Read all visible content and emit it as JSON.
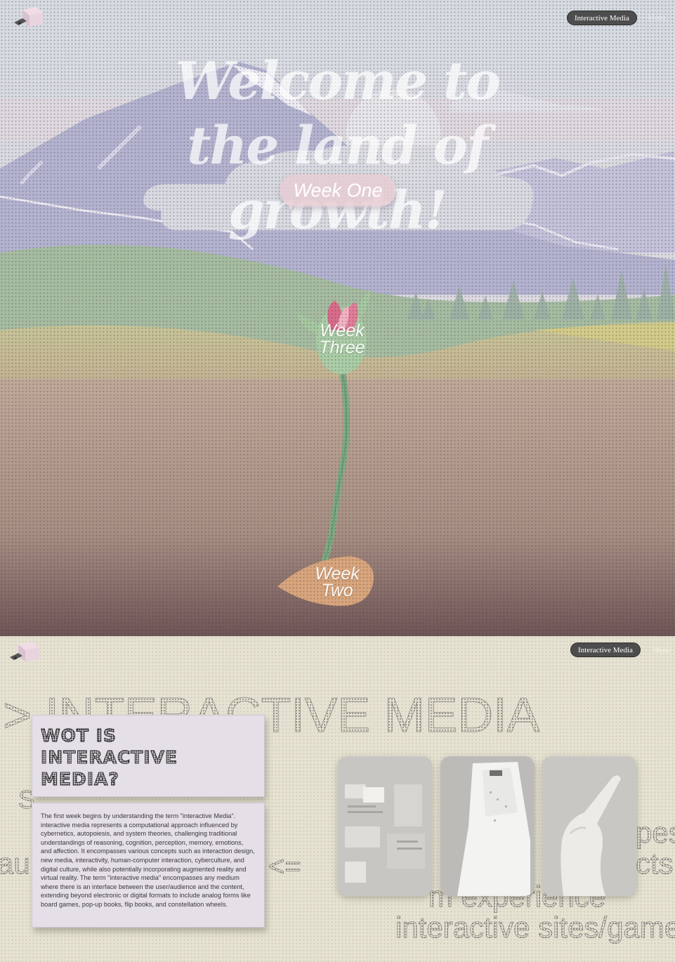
{
  "hero": {
    "nav": {
      "pill_label": "Interactive Media",
      "menu_label": "Menu"
    },
    "title": "Welcome to the land of growth!",
    "week_one": "Week One",
    "week_three": "Week Three",
    "week_two": "Week Two"
  },
  "im": {
    "nav": {
      "pill_label": "Interactive Media",
      "menu_label": "Menu"
    },
    "background_words": {
      "heading": "> INTERACTIVE MEDIA",
      "left_top": "S",
      "left_mid": "au",
      "arrow": "<=",
      "right_1": "pes",
      "right_2": "cts",
      "right_3": "m      experience",
      "right_4": "interactive sites/game"
    },
    "card": {
      "title": "WOT IS\nINTERACTIVE\nMEDIA?",
      "body": "The first week begins by understanding the term \"interactive Media\". interactive media represents a computational approach influenced by cybernetics, autopoiesis, and system theories, challenging traditional understandings of reasoning, cognition, perception, memory, emotions, and affection. It encompasses various concepts such as interaction design, new media, interactivity, human-computer interaction, cyberculture, and digital culture, while also potentially incorporating augmented reality and virtual reality. The term \"interactive media\" encompasses any medium where there is an interface between the user/audience and the content, extending beyond electronic or digital formats to include analog forms like board games, pop-up books, flip books, and constellation wheels."
    },
    "photos": [
      "photo-collage-1",
      "photo-paper-model",
      "photo-hand-pointing"
    ]
  },
  "colors": {
    "sky": "#d9dde3",
    "mountain": "#b3b4d2",
    "meadow": "#9db598",
    "field": "#c9c48e",
    "soil": "#b39a8d",
    "beige": "#e6e2d2",
    "pill": "#4d4d4d"
  }
}
